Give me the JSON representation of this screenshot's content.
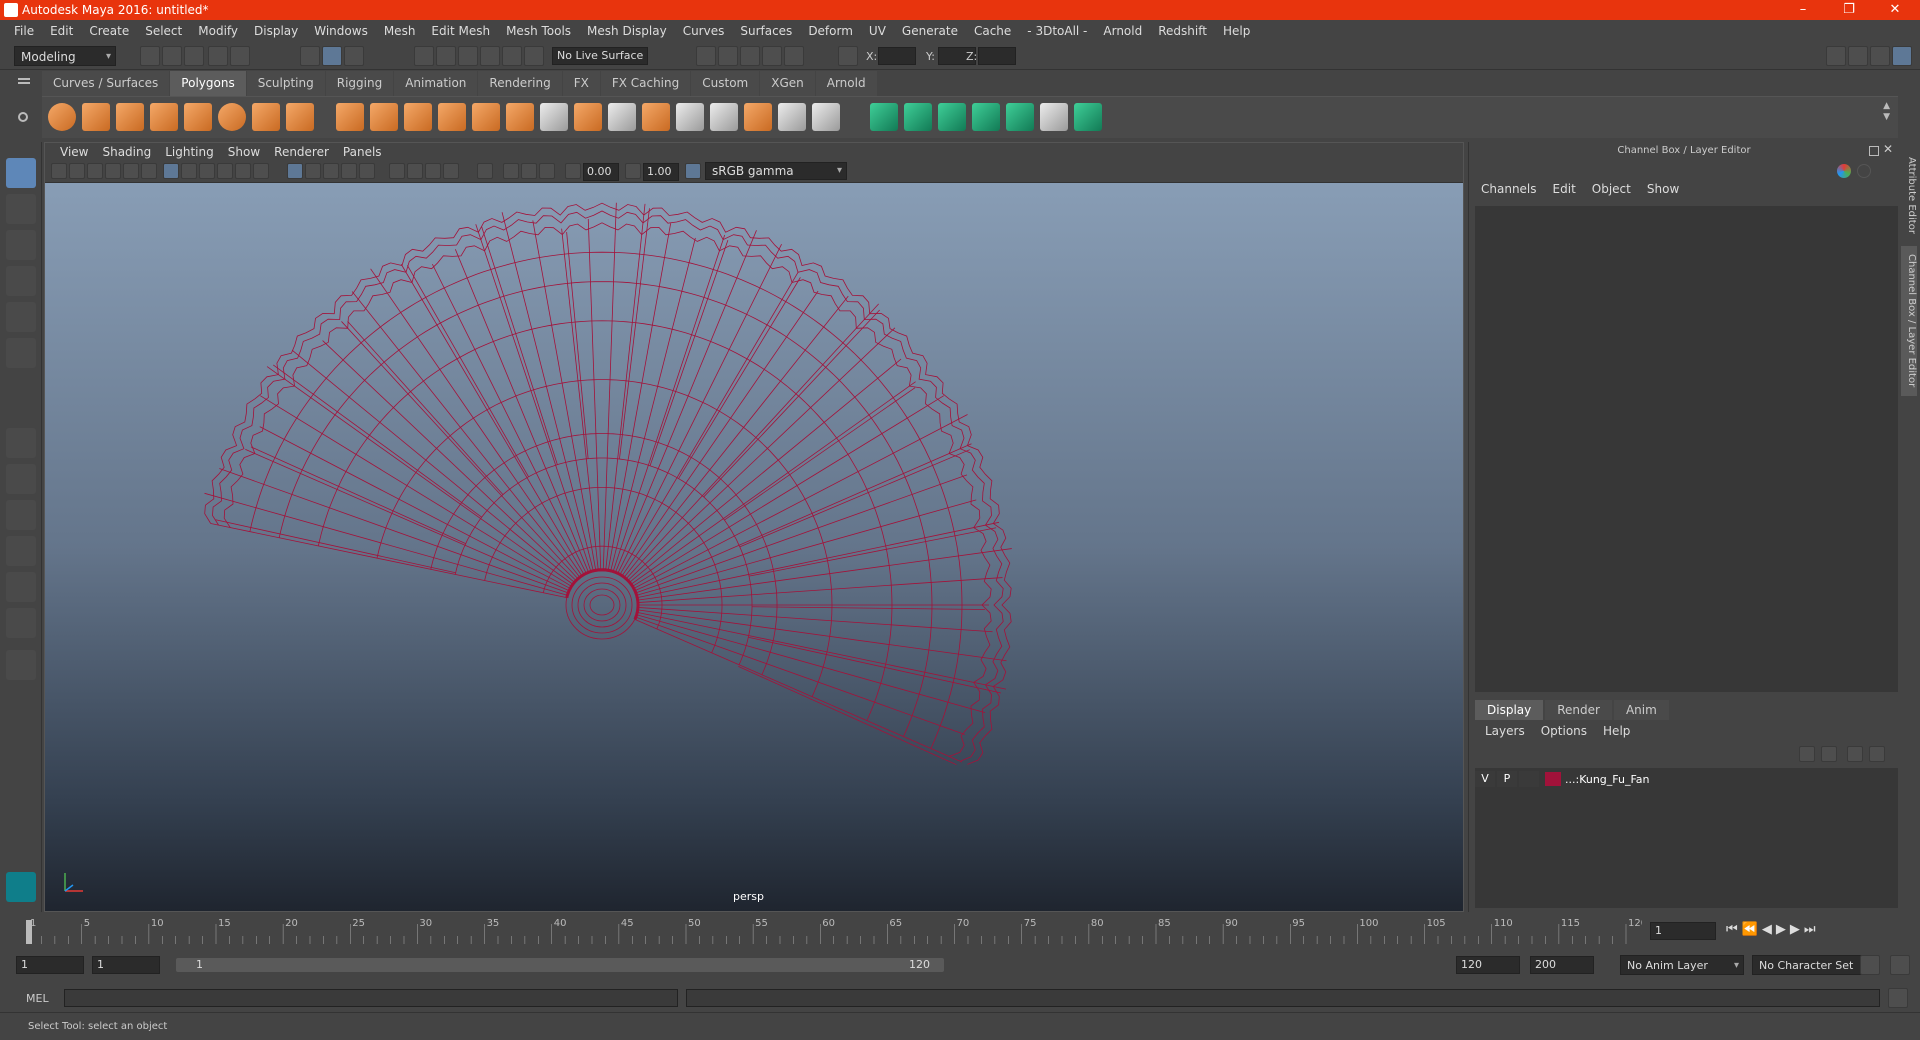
{
  "window": {
    "title": "Autodesk Maya 2016: untitled*",
    "controls": [
      "–",
      "❐",
      "✕"
    ]
  },
  "menubar": [
    "File",
    "Edit",
    "Create",
    "Select",
    "Modify",
    "Display",
    "Windows",
    "Mesh",
    "Edit Mesh",
    "Mesh Tools",
    "Mesh Display",
    "Curves",
    "Surfaces",
    "Deform",
    "UV",
    "Generate",
    "Cache",
    "- 3DtoAll -",
    "Arnold",
    "Redshift",
    "Help"
  ],
  "status": {
    "mode": "Modeling",
    "live_surface": "No Live Surface",
    "x_label": "X:",
    "y_label": "Y:",
    "z_label": "Z:"
  },
  "shelf": {
    "tabs": [
      "Curves / Surfaces",
      "Polygons",
      "Sculpting",
      "Rigging",
      "Animation",
      "Rendering",
      "FX",
      "FX Caching",
      "Custom",
      "XGen",
      "Arnold"
    ],
    "active": "Polygons"
  },
  "viewport": {
    "menu": [
      "View",
      "Shading",
      "Lighting",
      "Show",
      "Renderer",
      "Panels"
    ],
    "exposure": "0.00",
    "gamma": "1.00",
    "color_space": "sRGB gamma",
    "camera": "persp",
    "wire_color": "#a3123a"
  },
  "channelbox": {
    "title": "Channel Box / Layer Editor",
    "menu": [
      "Channels",
      "Edit",
      "Object",
      "Show"
    ]
  },
  "layer_editor": {
    "tabs": [
      "Display",
      "Render",
      "Anim"
    ],
    "active": "Display",
    "menu": [
      "Layers",
      "Options",
      "Help"
    ],
    "layer": {
      "v": "V",
      "p": "P",
      "name": "...:Kung_Fu_Fan",
      "color": "#a1123a"
    }
  },
  "side_tabs": [
    "Attribute Editor",
    "Channel Box / Layer Editor"
  ],
  "timeline": {
    "ticks": [
      "1",
      "5",
      "10",
      "15",
      "20",
      "25",
      "30",
      "35",
      "40",
      "45",
      "50",
      "55",
      "60",
      "65",
      "70",
      "75",
      "80",
      "85",
      "90",
      "95",
      "100",
      "105",
      "110",
      "115",
      "120"
    ],
    "current_frame": "1"
  },
  "range": {
    "start": "1",
    "playback_start": "1",
    "slider_start": "1",
    "slider_end": "120",
    "playback_end": "120",
    "end": "200",
    "anim_layer": "No Anim Layer",
    "char_set": "No Character Set"
  },
  "cmd": {
    "label": "MEL"
  },
  "help": {
    "text": "Select Tool: select an object"
  }
}
